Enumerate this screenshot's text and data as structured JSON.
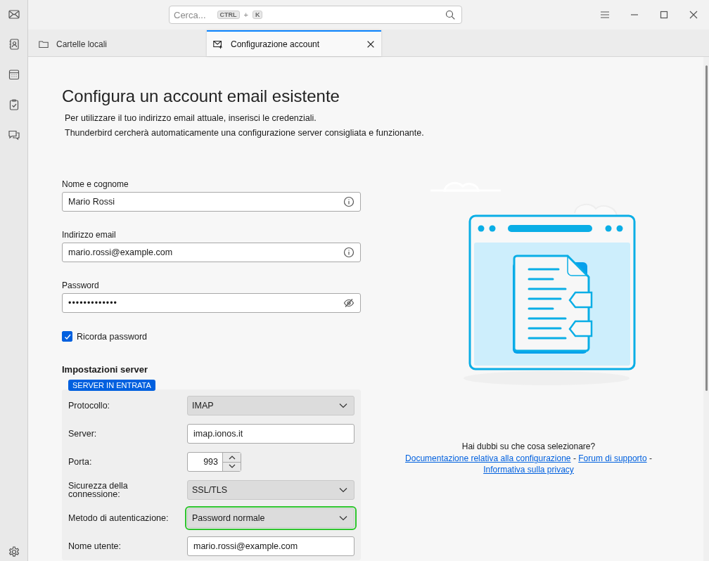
{
  "search": {
    "placeholder": "Cerca...",
    "keys": [
      "CTRL",
      "K"
    ],
    "joiner": "+"
  },
  "tabs": [
    {
      "label": "Cartelle locali",
      "kind": "folder",
      "selected": false,
      "closable": false
    },
    {
      "label": "Configurazione account",
      "kind": "mail",
      "selected": true,
      "closable": true
    }
  ],
  "heading": "Configura un account email esistente",
  "intro": [
    "Per utilizzare il tuo indirizzo email attuale, inserisci le credenziali.",
    "Thunderbird cercherà automaticamente una configurazione server consigliata e funzionante."
  ],
  "fields": [
    {
      "label": "Nome e cognome",
      "value": "Mario Rossi",
      "kind": "info"
    },
    {
      "label": "Indirizzo email",
      "value": "mario.rossi@example.com",
      "kind": "info"
    },
    {
      "label": "Password",
      "value": "•••••••••••••",
      "kind": "password"
    }
  ],
  "remember": {
    "label": "Ricorda password",
    "checked": true
  },
  "server": {
    "title": "Impostazioni server",
    "badge": "SERVER IN ENTRATA",
    "rows": [
      {
        "label": "Protocollo:",
        "value": "IMAP",
        "kind": "select",
        "highlighted": false
      },
      {
        "label": "Server:",
        "value": "imap.ionos.it",
        "kind": "text",
        "highlighted": false
      },
      {
        "label": "Porta:",
        "value": "993",
        "kind": "number",
        "highlighted": false
      },
      {
        "label": "Sicurezza della connessione:",
        "value": "SSL/TLS",
        "kind": "select",
        "highlighted": false
      },
      {
        "label": "Metodo di autenticazione:",
        "value": "Password normale",
        "kind": "select",
        "highlighted": true
      },
      {
        "label": "Nome utente:",
        "value": "mario.rossi@example.com",
        "kind": "text",
        "highlighted": false
      }
    ]
  },
  "help": {
    "question": "Hai dubbi su che cosa selezionare?",
    "separator": "-",
    "links": [
      "Documentazione relativa alla configurazione",
      "Forum di supporto",
      "Informativa sulla privacy"
    ]
  }
}
